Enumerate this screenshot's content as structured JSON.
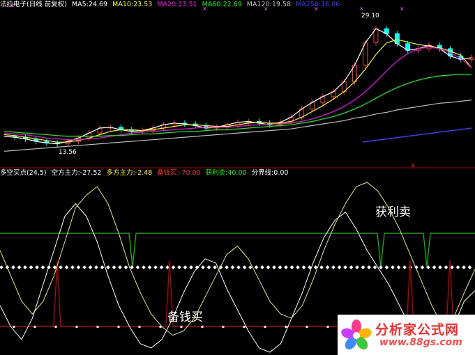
{
  "price_panel": {
    "title": "法拉电子(日线 前复权)",
    "ma5": "MA5:24.69",
    "ma10": "MA10:23.53",
    "ma20": "MA20:23.51",
    "ma60": "MA60:22.69",
    "ma120": "MA120:19.58",
    "ma250": "MA250:16.06",
    "high_label": "29.10",
    "low_label": "13.56",
    "mark_x": "××",
    "mark_s": "s"
  },
  "indicator_panel": {
    "name": "多空买点(24,5)",
    "empty_force": "空方主力:-27.52",
    "long_force": "多方主力:-2.48",
    "buy_ready": "备钱买:-70.00",
    "take_profit": "获利卖:40.00",
    "boundary": "分界线:0.00",
    "annotation_sell": "获利卖",
    "annotation_buy": "备钱买"
  },
  "watermark": {
    "name": "分析家公式网",
    "url": "www.88gs.com"
  },
  "colors": {
    "up": "#ff3232",
    "down": "#00ffff",
    "ma5": "#ffffff",
    "ma10": "#ffff00",
    "ma20": "#ff00ff",
    "ma60": "#00ff00",
    "ma120": "#c0c0c0",
    "ma250": "#3c3cff",
    "take_profit_line": "#00c800",
    "buy_ready_line": "#c80000",
    "divider": "#b00000"
  },
  "chart_data": [
    {
      "type": "line",
      "title": "",
      "series": [
        {
          "name": "MA5",
          "values": [
            15.2,
            15.1,
            14.9,
            14.6,
            14.4,
            14.3,
            14.6,
            15.0,
            15.6,
            16.2,
            16.3,
            16.0,
            15.8,
            15.9,
            16.2,
            16.6,
            16.8,
            16.7,
            16.5,
            16.2,
            16.3,
            16.6,
            16.9,
            17.0,
            16.8,
            16.6,
            16.9,
            17.5,
            18.5,
            19.3,
            20.0,
            20.6,
            21.8,
            23.8,
            26.5,
            28.2,
            27.6,
            26.4,
            25.6,
            25.8,
            26.2,
            25.8,
            24.9,
            24.5,
            24.7
          ]
        },
        {
          "name": "MA10",
          "values": [
            15.4,
            15.3,
            15.1,
            14.9,
            14.7,
            14.5,
            14.5,
            14.7,
            15.0,
            15.4,
            15.8,
            16.0,
            16.0,
            15.9,
            16.0,
            16.2,
            16.4,
            16.6,
            16.6,
            16.5,
            16.4,
            16.4,
            16.6,
            16.8,
            16.9,
            16.8,
            16.8,
            17.0,
            17.5,
            18.2,
            18.9,
            19.7,
            20.6,
            21.8,
            23.3,
            25.1,
            26.5,
            26.9,
            26.6,
            26.3,
            26.1,
            25.9,
            25.5,
            25.0,
            23.5
          ]
        },
        {
          "name": "MA20",
          "values": [
            15.6,
            15.5,
            15.4,
            15.2,
            15.0,
            14.9,
            14.8,
            14.8,
            14.9,
            15.0,
            15.2,
            15.4,
            15.6,
            15.7,
            15.8,
            15.9,
            16.0,
            16.1,
            16.2,
            16.3,
            16.3,
            16.3,
            16.4,
            16.5,
            16.6,
            16.7,
            16.7,
            16.8,
            17.0,
            17.3,
            17.7,
            18.2,
            18.8,
            19.6,
            20.6,
            21.8,
            23.1,
            24.3,
            25.2,
            25.8,
            26.0,
            25.8,
            25.3,
            24.6,
            23.5
          ]
        },
        {
          "name": "MA60",
          "values": [
            15.8,
            15.7,
            15.6,
            15.5,
            15.4,
            15.3,
            15.2,
            15.2,
            15.2,
            15.2,
            15.3,
            15.3,
            15.4,
            15.5,
            15.5,
            15.6,
            15.7,
            15.8,
            15.8,
            15.9,
            16.0,
            16.0,
            16.1,
            16.2,
            16.3,
            16.4,
            16.5,
            16.6,
            16.8,
            17.0,
            17.3,
            17.6,
            18.0,
            18.5,
            19.1,
            19.8,
            20.5,
            21.1,
            21.6,
            22.0,
            22.3,
            22.5,
            22.6,
            22.7,
            22.69
          ]
        },
        {
          "name": "MA120",
          "values": [
            13.4,
            13.5,
            13.6,
            13.7,
            13.8,
            13.9,
            14.0,
            14.1,
            14.2,
            14.3,
            14.4,
            14.5,
            14.6,
            14.7,
            14.8,
            14.9,
            15.0,
            15.1,
            15.2,
            15.3,
            15.4,
            15.5,
            15.6,
            15.7,
            15.8,
            15.9,
            16.0,
            16.1,
            16.3,
            16.5,
            16.7,
            16.9,
            17.1,
            17.4,
            17.6,
            17.9,
            18.1,
            18.4,
            18.6,
            18.8,
            19.0,
            19.2,
            19.3,
            19.45,
            19.58
          ]
        }
      ]
    },
    {
      "type": "line",
      "title": "",
      "series": [
        {
          "name": "空方主力",
          "values": [
            -45,
            -70,
            -85,
            -60,
            -20,
            20,
            60,
            75,
            60,
            30,
            -10,
            -45,
            -70,
            -90,
            -95,
            -85,
            -60,
            -30,
            -5,
            10,
            5,
            -25,
            -50,
            -75,
            -95,
            -100,
            -90,
            -60,
            -30,
            5,
            35,
            55,
            65,
            45,
            20,
            0,
            -20,
            -45,
            -70,
            -90,
            -100,
            -95,
            -70,
            -40,
            -27.52
          ]
        },
        {
          "name": "多方主力",
          "values": [
            20,
            -10,
            -40,
            -55,
            -40,
            -10,
            30,
            70,
            85,
            95,
            75,
            40,
            0,
            -30,
            -55,
            -70,
            -80,
            -75,
            -60,
            -35,
            -10,
            15,
            25,
            10,
            -15,
            -40,
            -55,
            -60,
            -45,
            -15,
            20,
            50,
            75,
            95,
            100,
            90,
            70,
            45,
            15,
            -15,
            -45,
            -70,
            -60,
            -30,
            -2.48
          ]
        }
      ],
      "constants": {
        "take_profit": 40,
        "buy_ready": -70,
        "boundary": 0
      }
    }
  ]
}
